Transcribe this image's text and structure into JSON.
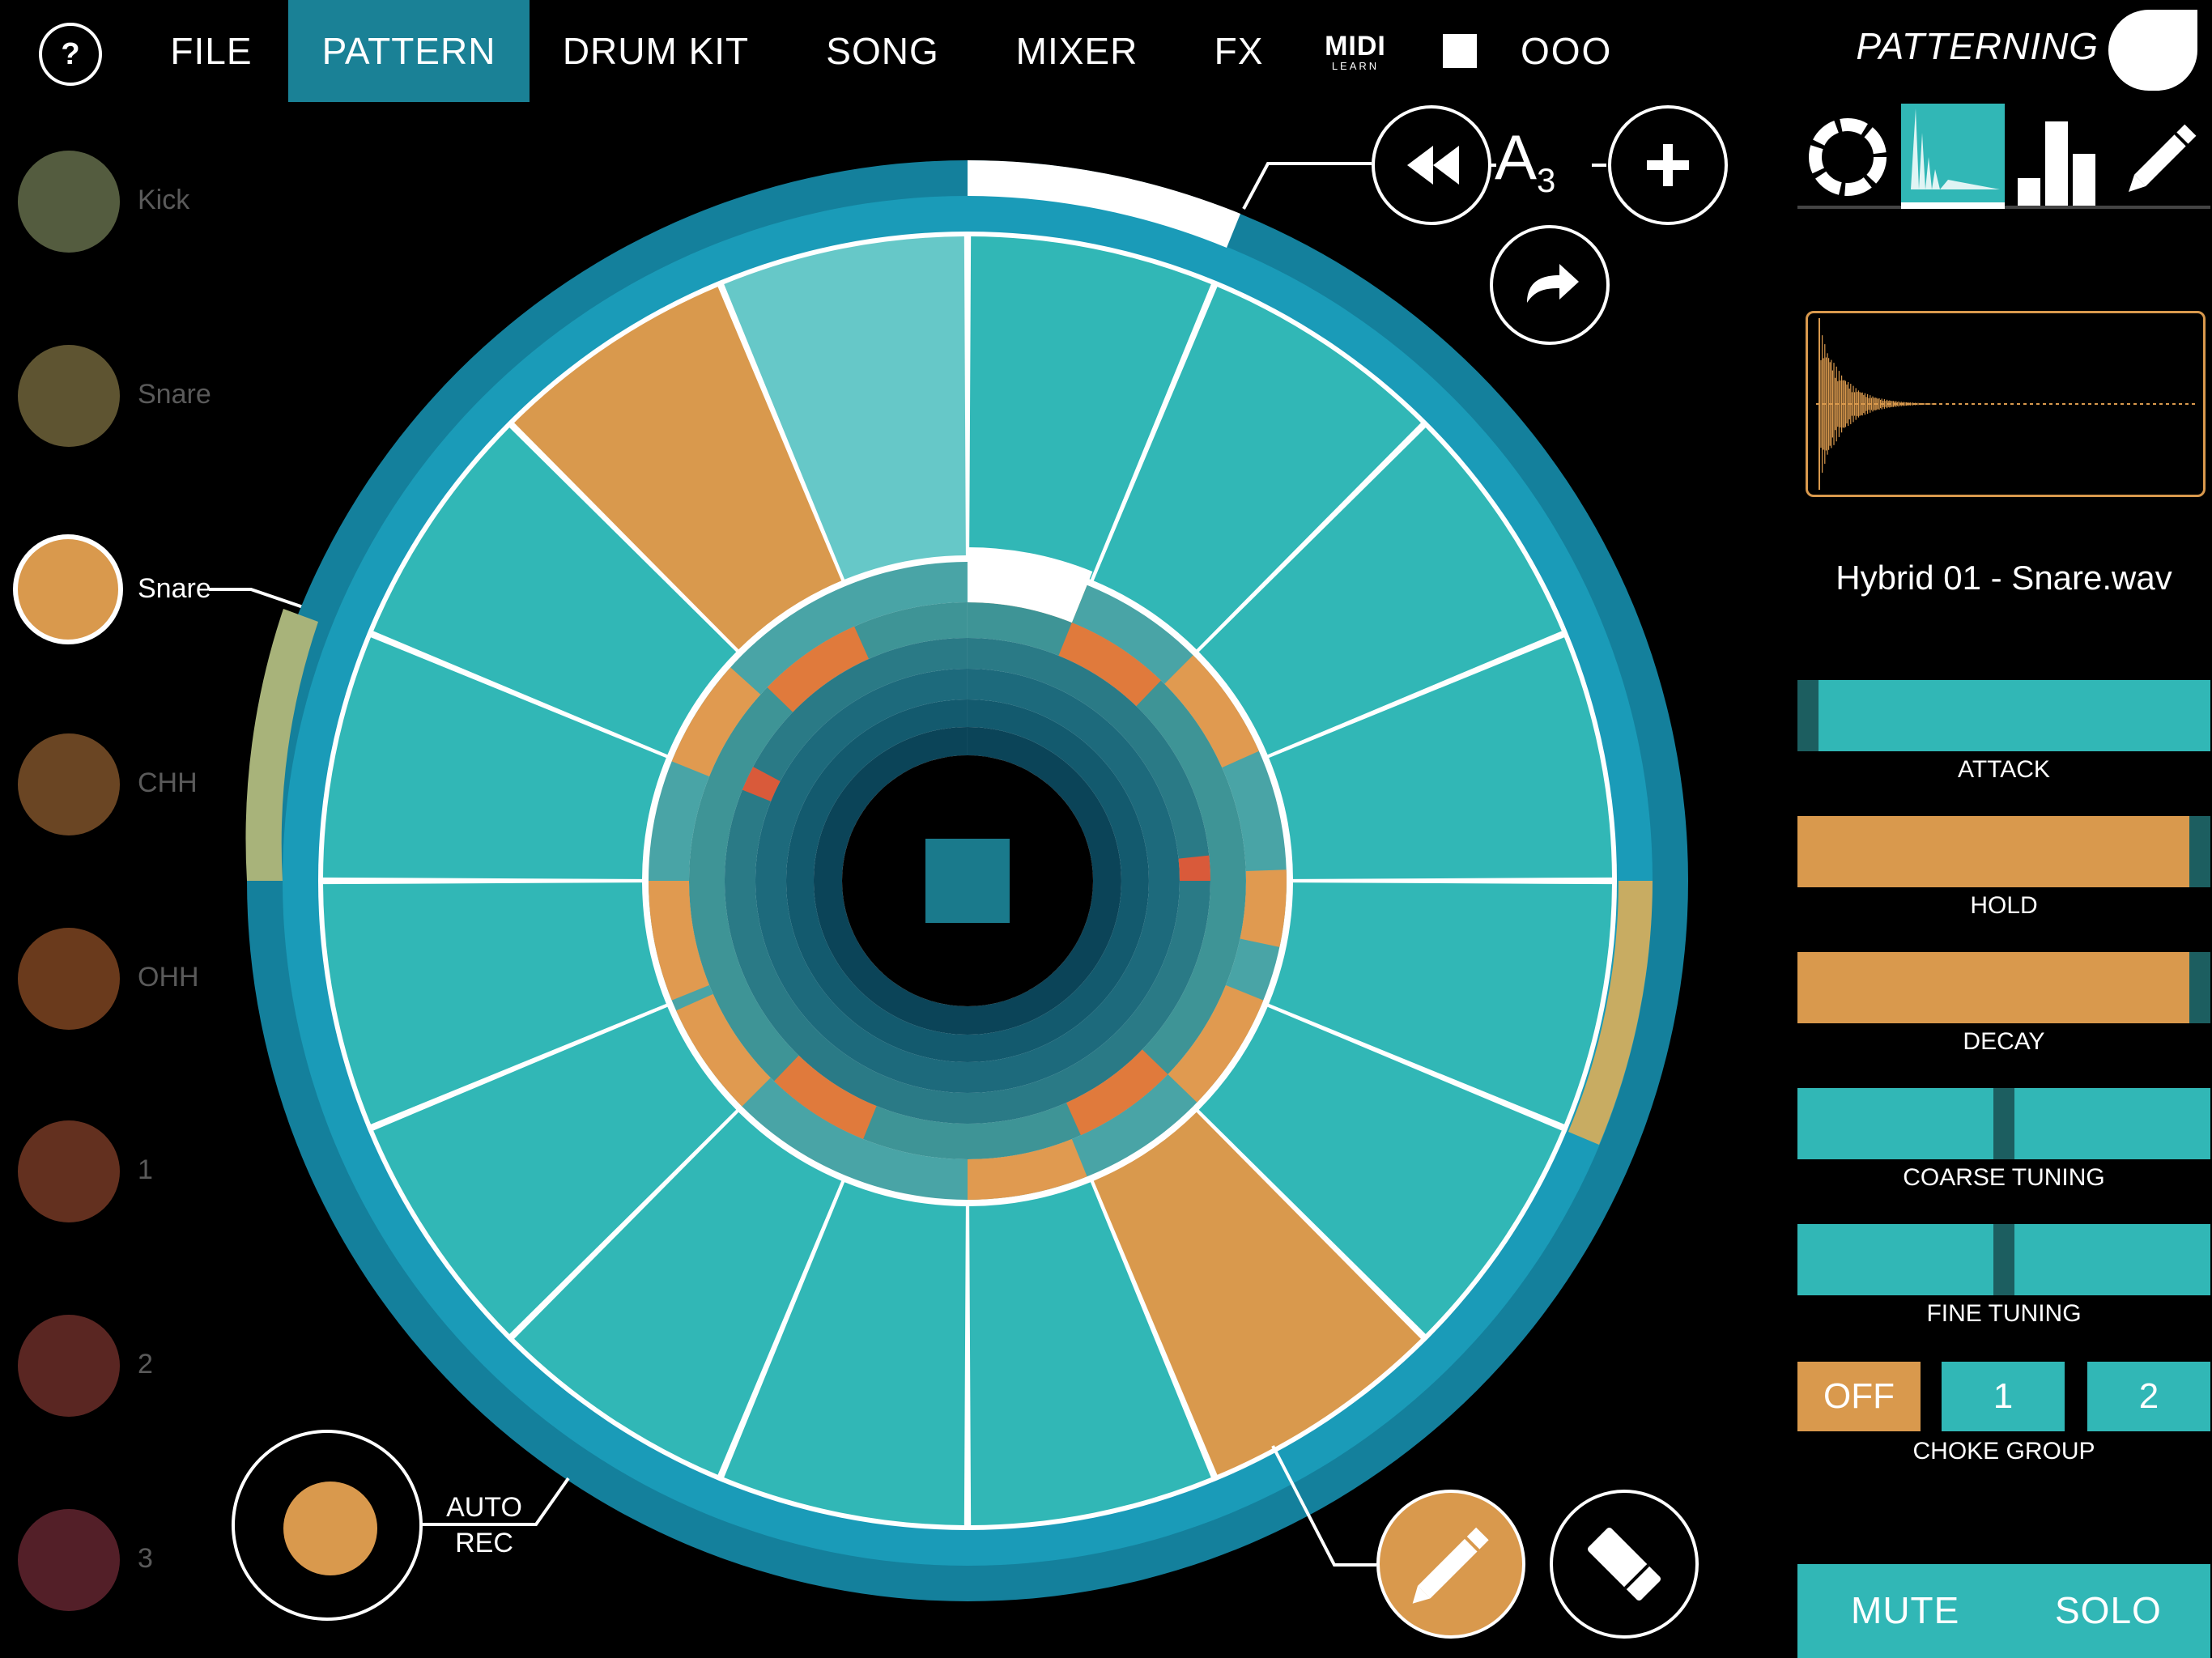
{
  "menu": {
    "help": "?",
    "items": [
      "FILE",
      "PATTERN",
      "DRUM KIT",
      "SONG",
      "MIXER",
      "FX"
    ],
    "active": "PATTERN",
    "midi_main": "MIDI",
    "midi_sub": "LEARN",
    "more": "OOO",
    "brand": "PATTERNING"
  },
  "instruments": [
    {
      "label": "Kick",
      "color": "#545c3f"
    },
    {
      "label": "Snare",
      "color": "#5e5431"
    },
    {
      "label": "Snare",
      "color": "#d9994d",
      "selected": true
    },
    {
      "label": "CHH",
      "color": "#6a4523"
    },
    {
      "label": "OHH",
      "color": "#6a3a1c"
    },
    {
      "label": "1",
      "color": "#63301f"
    },
    {
      "label": "2",
      "color": "#5a2622"
    },
    {
      "label": "3",
      "color": "#531f28"
    }
  ],
  "pattern": {
    "name_letter": "A",
    "name_sub": "3",
    "steps": 16,
    "active_steps": [
      14,
      6
    ],
    "current_step": 15,
    "auto_rec_line1": "AUTO",
    "auto_rec_line2": "REC"
  },
  "colors": {
    "teal": "#31b7b6",
    "orange": "#d9994d",
    "ring": "#1a9bb8",
    "ring_dark": "#14809c",
    "accent": "#e07a3c"
  },
  "sample": {
    "filename": "Hybrid 01 - Snare.wav"
  },
  "params": [
    {
      "label": "ATTACK",
      "value": 0.0,
      "color": "#31b7b6"
    },
    {
      "label": "HOLD",
      "value": 1.0,
      "color": "#d9994d"
    },
    {
      "label": "DECAY",
      "value": 1.0,
      "color": "#d9994d"
    },
    {
      "label": "COARSE TUNING",
      "value": 0.5,
      "color": "#31b7b6"
    },
    {
      "label": "FINE TUNING",
      "value": 0.5,
      "color": "#31b7b6"
    }
  ],
  "choke": {
    "label": "CHOKE GROUP",
    "options": [
      "OFF",
      "1",
      "2"
    ],
    "selected": "OFF"
  },
  "mute_label": "MUTE",
  "solo_label": "SOLO",
  "icons": {
    "rewind": "rewind-icon",
    "add": "plus-icon",
    "redo": "redo-icon",
    "stop": "stop-icon",
    "pencil": "pencil-icon",
    "eraser": "eraser-icon",
    "help": "question-icon"
  }
}
